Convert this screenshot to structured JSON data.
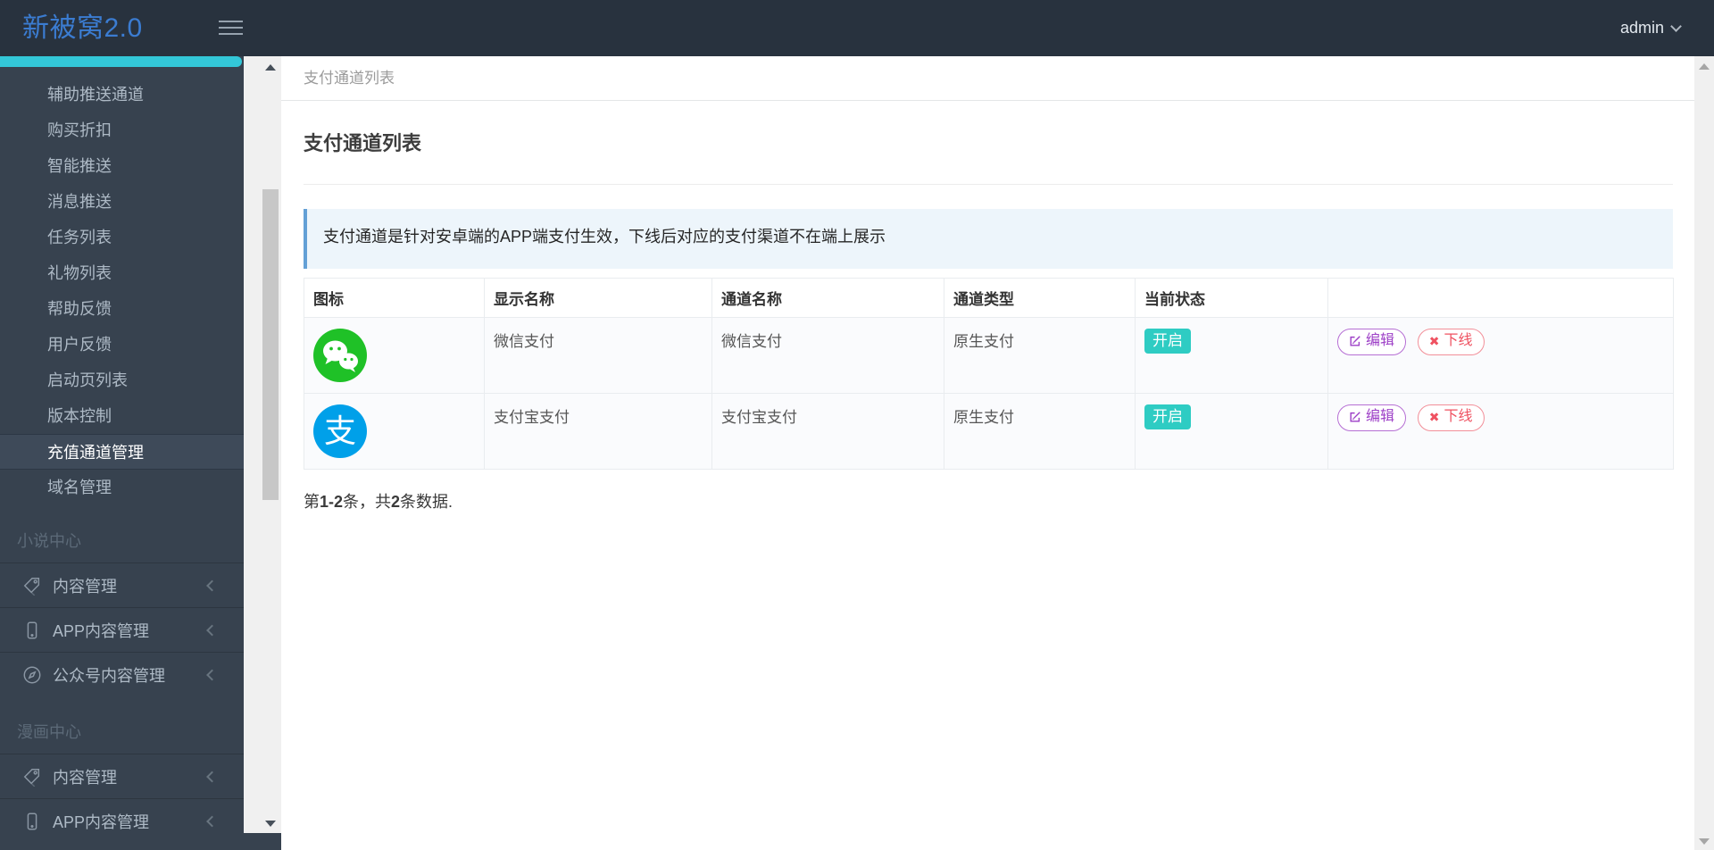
{
  "header": {
    "logo": "新被窝2.0",
    "user": "admin",
    "icons": {
      "toggle": "hamburger-icon",
      "user_caret": "chevron-down-icon"
    }
  },
  "sidebar": {
    "simple": [
      "辅助推送通道",
      "购买折扣",
      "智能推送",
      "消息推送",
      "任务列表",
      "礼物列表",
      "帮助反馈",
      "用户反馈",
      "启动页列表",
      "版本控制",
      "充值通道管理",
      "域名管理"
    ],
    "active_item": "充值通道管理",
    "sections": [
      {
        "title": "小说中心",
        "items": [
          {
            "icon": "tags-icon",
            "label": "内容管理"
          },
          {
            "icon": "mobile-icon",
            "label": "APP内容管理"
          },
          {
            "icon": "compass-icon",
            "label": "公众号内容管理"
          }
        ]
      },
      {
        "title": "漫画中心",
        "items": [
          {
            "icon": "tags-icon",
            "label": "内容管理"
          },
          {
            "icon": "mobile-icon",
            "label": "APP内容管理"
          }
        ]
      }
    ]
  },
  "breadcrumb": {
    "label": "支付通道列表"
  },
  "page": {
    "title": "支付通道列表",
    "alert": "支付通道是针对安卓端的APP端支付生效，下线后对应的支付渠道不在端上展示"
  },
  "table": {
    "headers": [
      "图标",
      "显示名称",
      "通道名称",
      "通道类型",
      "当前状态",
      ""
    ],
    "rows": [
      {
        "icon": "wechat-icon",
        "display_name": "微信支付",
        "channel_name": "微信支付",
        "channel_type": "原生支付",
        "status": "开启",
        "actions": {
          "edit": "编辑",
          "offline": "下线"
        }
      },
      {
        "icon": "alipay-icon",
        "alipay_glyph": "支",
        "display_name": "支付宝支付",
        "channel_name": "支付宝支付",
        "channel_type": "原生支付",
        "status": "开启",
        "actions": {
          "edit": "编辑",
          "offline": "下线"
        }
      }
    ]
  },
  "summary": {
    "prefix": "第",
    "range": "1-2",
    "middle": "条，共",
    "total": "2",
    "suffix": "条数据."
  },
  "colors": {
    "header_bg": "#28323e",
    "sidebar_bg": "#37424f",
    "accent_teal": "#33c7d8",
    "logo_blue": "#3b7cd1",
    "alert_bg": "#edf5fb",
    "alert_border": "#63a0d6",
    "badge_teal": "#2eccc3",
    "edit_purple": "#9d3fc7",
    "offline_red": "#ef5261",
    "wechat_green": "#1fc127",
    "alipay_blue": "#00a0e9"
  }
}
